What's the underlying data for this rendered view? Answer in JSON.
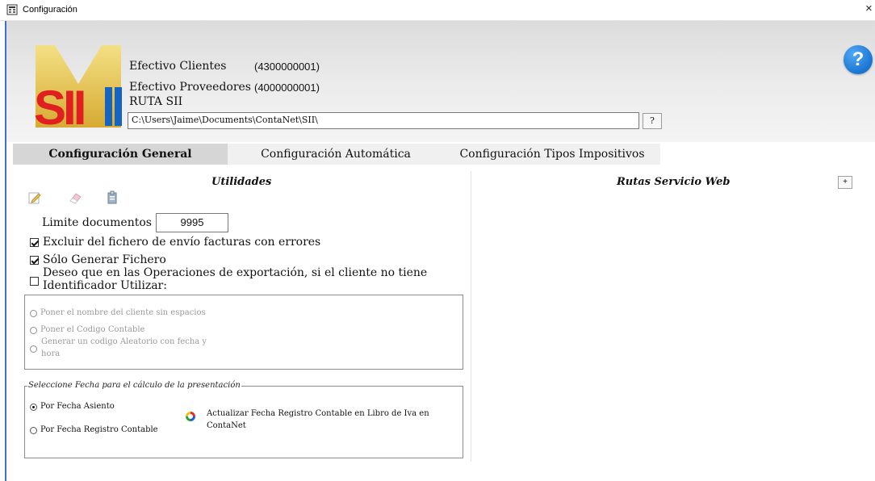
{
  "window": {
    "title": "Configuración",
    "close_label": "×"
  },
  "header": {
    "logo_text": "SII",
    "efectivo_clientes_label": "Efectivo Clientes",
    "efectivo_clientes_value": "(4300000001)",
    "efectivo_proveedores_label": "Efectivo Proveedores",
    "efectivo_proveedores_value": "(4000000001)",
    "ruta_sii_label": "RUTA SII",
    "ruta_sii_value": "C:\\Users\\Jaime\\Documents\\ContaNet\\SII\\",
    "browse_label": "?",
    "help_label": "?"
  },
  "tabs": [
    {
      "label": "Configuración General",
      "active": true
    },
    {
      "label": "Configuración Automática",
      "active": false
    },
    {
      "label": "Configuración Tipos Impositivos",
      "active": false
    }
  ],
  "utilidades": {
    "title": "Utilidades",
    "tool_icons": [
      "edit-icon",
      "eraser-icon",
      "clipboard-icon"
    ],
    "limite_label": "Limite documentos",
    "limite_value": "9995",
    "checks": [
      {
        "label": "Excluir del fichero de envío facturas con errores",
        "checked": true
      },
      {
        "label": "Sólo Generar Fichero",
        "checked": true
      },
      {
        "label_line1": "Deseo que en las Operaciones de exportación, si el cliente no tiene",
        "label_line2": "Identificador Utilizar:",
        "checked": false
      }
    ],
    "id_options": [
      {
        "label": "Poner el nombre del cliente sin espacios"
      },
      {
        "label": "Poner el Codigo Contable"
      },
      {
        "label_line1": "Generar un codigo Aleatorio con fecha y",
        "label_line2": "hora"
      }
    ],
    "fecha_group": {
      "legend": "Seleccione Fecha para el cálculo de la presentación",
      "options": [
        {
          "label": "Por Fecha Asiento",
          "checked": true
        },
        {
          "label": "Por Fecha Registro Contable",
          "checked": false
        }
      ],
      "update_line1": "Actualizar Fecha Registro Contable en Libro de Iva en",
      "update_line2": "ContaNet"
    }
  },
  "rutas": {
    "title": "Rutas Servicio Web",
    "add_label": "+"
  },
  "colors": {
    "accent_blue": "#1a74d2",
    "window_border": "#3b73c8",
    "tab_active": "#d6d6d6"
  }
}
